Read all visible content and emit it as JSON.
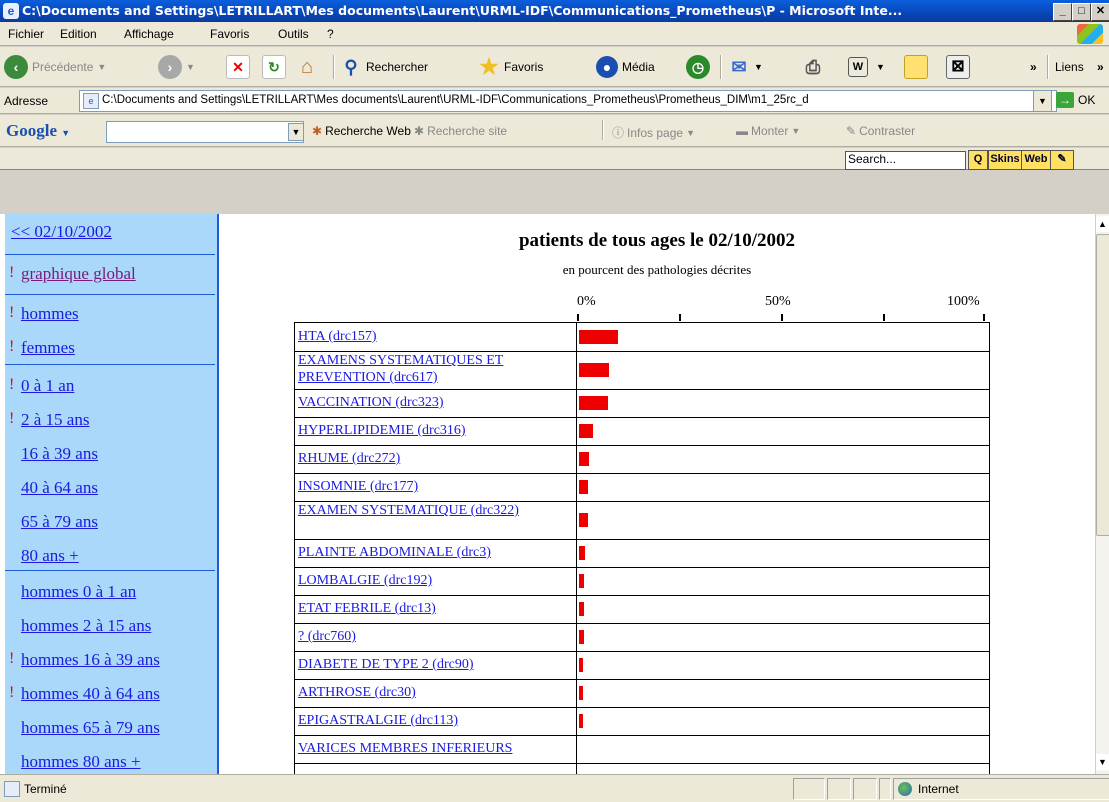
{
  "window": {
    "title": "C:\\Documents and Settings\\LETRILLART\\Mes documents\\Laurent\\URML-IDF\\Communications_Prometheus\\P - Microsoft Inte...",
    "min": "_",
    "max": "□",
    "close": "✕"
  },
  "menu": [
    "Fichier",
    "Edition",
    "Affichage",
    "Favoris",
    "Outils",
    "?"
  ],
  "toolbar": {
    "back": "Précédente",
    "search": "Rechercher",
    "favorites": "Favoris",
    "media": "Média",
    "chevron": "»",
    "links": "Liens"
  },
  "address": {
    "label": "Adresse",
    "url": "C:\\Documents and Settings\\LETRILLART\\Mes documents\\Laurent\\URML-IDF\\Communications_Prometheus\\Prometheus_DIM\\m1_25rc_d",
    "go": "OK"
  },
  "google": {
    "logo": "Google",
    "web_search": "Recherche Web",
    "site_search": "Recherche site",
    "page_info": "Infos page",
    "up": "Monter",
    "contrast": "Contraster"
  },
  "searchbar": {
    "placeholder": "Search...",
    "skins": "Skins",
    "web": "Web"
  },
  "nav": {
    "date_link": "<< 02/10/2002",
    "global": "graphique global",
    "men": "hommes",
    "women": "femmes",
    "ages": [
      "0 à 1 an",
      "2 à 15 ans",
      "16 à 39 ans",
      "40 à 64 ans",
      "65 à 79 ans",
      "80 ans +"
    ],
    "men_ages": [
      "hommes 0 à 1 an",
      "hommes 2 à 15 ans",
      "hommes 16 à 39 ans",
      "hommes 40 à 64 ans",
      "hommes 65 à 79 ans",
      "hommes 80 ans +"
    ],
    "excl": "!"
  },
  "chart_title": "patients de tous ages le 02/10/2002",
  "chart_subtitle": "en pourcent des pathologies décrites",
  "chart_data": {
    "type": "bar",
    "ticks": [
      "0%",
      "50%",
      "100%"
    ],
    "categories": [
      "HTA (drc157)",
      "EXAMENS SYSTEMATIQUES ET PREVENTION (drc617)",
      "VACCINATION (drc323)",
      "HYPERLIPIDEMIE (drc316)",
      "RHUME (drc272)",
      "INSOMNIE (drc177)",
      "EXAMEN SYSTEMATIQUE (drc322)",
      "PLAINTE ABDOMINALE (drc3)",
      "LOMBALGIE (drc192)",
      "ETAT FEBRILE (drc13)",
      "? (drc760)",
      "DIABETE DE TYPE 2 (drc90)",
      "ARTHROSE (drc30)",
      "EPIGASTRALGIE (drc113)",
      "VARICES MEMBRES INFERIEURS"
    ],
    "values": [
      9.5,
      7.5,
      7.2,
      3.5,
      2.5,
      2.3,
      2.3,
      1.5,
      1.3,
      1.3,
      1.3,
      1.0,
      1.0,
      1.0,
      0
    ],
    "xlim": [
      0,
      100
    ]
  },
  "status": {
    "text": "Terminé",
    "zone": "Internet"
  }
}
